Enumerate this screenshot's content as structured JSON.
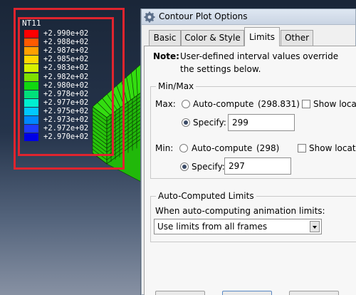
{
  "viewport": {
    "legend": {
      "title": "NT11",
      "entries": [
        {
          "label": "+2.990e+02",
          "color": "#ff0000"
        },
        {
          "label": "+2.988e+02",
          "color": "#ff5a00"
        },
        {
          "label": "+2.987e+02",
          "color": "#ffa000"
        },
        {
          "label": "+2.985e+02",
          "color": "#ffd700"
        },
        {
          "label": "+2.983e+02",
          "color": "#d6f000"
        },
        {
          "label": "+2.982e+02",
          "color": "#7ee000"
        },
        {
          "label": "+2.980e+02",
          "color": "#10d810"
        },
        {
          "label": "+2.978e+02",
          "color": "#00e07a"
        },
        {
          "label": "+2.977e+02",
          "color": "#00f0d0"
        },
        {
          "label": "+2.975e+02",
          "color": "#00c8ff"
        },
        {
          "label": "+2.973e+02",
          "color": "#0088ff"
        },
        {
          "label": "+2.972e+02",
          "color": "#1f3cff"
        },
        {
          "label": "+2.970e+02",
          "color": "#0000e6"
        }
      ]
    },
    "highlight_color": "#e0242e",
    "mesh_color": "#33dd10"
  },
  "dialog": {
    "title": "Contour Plot Options",
    "title_icon": "gear-icon",
    "tabs": [
      {
        "label": "Basic",
        "active": false
      },
      {
        "label": "Color & Style",
        "active": false
      },
      {
        "label": "Limits",
        "active": true
      },
      {
        "label": "Other",
        "active": false
      }
    ],
    "note": {
      "label": "Note:",
      "line1": "User-defined interval values override",
      "line2": "the settings below."
    },
    "minmax": {
      "group_title": "Min/Max",
      "max": {
        "label": "Max:",
        "auto_label": "Auto-compute",
        "auto_value": "(298.831)",
        "show_location_label": "Show loca",
        "specify_label": "Specify:",
        "specify_value": "299",
        "selected": "specify"
      },
      "min": {
        "label": "Min:",
        "auto_label": "Auto-compute",
        "auto_value": "(298)",
        "show_location_label": "Show locati",
        "specify_label": "Specify:",
        "specify_value": "297",
        "selected": "specify"
      }
    },
    "auto_limits": {
      "group_title": "Auto-Computed Limits",
      "prompt": "When auto-computing animation limits:",
      "selected_option": "Use limits from all frames"
    }
  }
}
